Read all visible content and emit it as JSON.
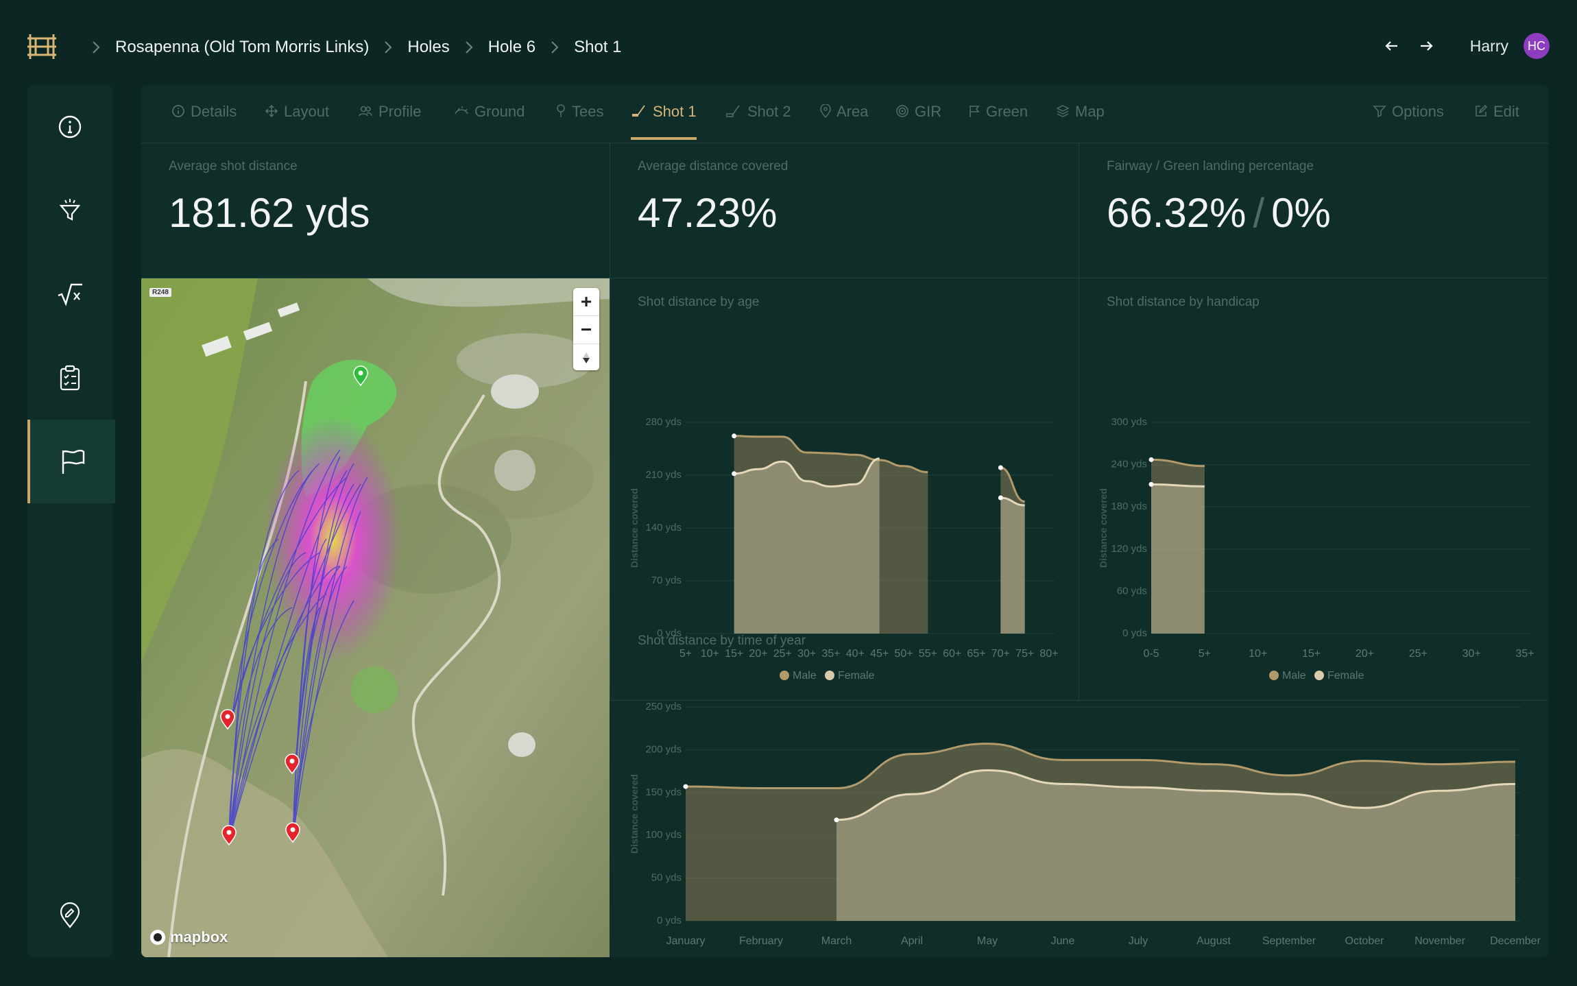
{
  "breadcrumb": {
    "items": [
      "Rosapenna (Old Tom Morris Links)",
      "Holes",
      "Hole 6",
      "Shot 1"
    ]
  },
  "user": {
    "name": "Harry",
    "initials": "HC"
  },
  "tabs": [
    {
      "label": "Details",
      "icon": "info-icon"
    },
    {
      "label": "Layout",
      "icon": "move-icon"
    },
    {
      "label": "Profile",
      "icon": "users-icon"
    },
    {
      "label": "Ground",
      "icon": "ground-icon"
    },
    {
      "label": "Tees",
      "icon": "tee-icon"
    },
    {
      "label": "Shot 1",
      "icon": "club-icon",
      "active": true
    },
    {
      "label": "Shot 2",
      "icon": "club-icon"
    },
    {
      "label": "Area",
      "icon": "pin-icon"
    },
    {
      "label": "GIR",
      "icon": "target-icon"
    },
    {
      "label": "Green",
      "icon": "flag-icon"
    },
    {
      "label": "Map",
      "icon": "layers-icon"
    }
  ],
  "actions": {
    "options": "Options",
    "edit": "Edit"
  },
  "kpis": {
    "avg_shot_distance": {
      "label": "Average shot distance",
      "value": "181.62 yds"
    },
    "avg_distance_covered": {
      "label": "Average distance covered",
      "value": "47.23%"
    },
    "landing_pct": {
      "label": "Fairway / Green landing percentage",
      "fairway": "66.32%",
      "green": "0%",
      "separator": "/"
    }
  },
  "map": {
    "badge": "R248",
    "attribution": "mapbox"
  },
  "colors": {
    "male": "#b39a6b",
    "female": "#d8cba9",
    "accent": "#c9a86a",
    "background": "#0c2723",
    "panel": "#0f2e29"
  },
  "chart_data": [
    {
      "id": "age",
      "type": "area",
      "title": "Shot distance by age",
      "ylabel": "Distance covered",
      "ytick_labels": [
        "0 yds",
        "70 yds",
        "140 yds",
        "210 yds",
        "280 yds"
      ],
      "ylim": [
        0,
        280
      ],
      "categories": [
        "5+",
        "10+",
        "15+",
        "20+",
        "25+",
        "30+",
        "35+",
        "40+",
        "45+",
        "50+",
        "55+",
        "60+",
        "65+",
        "70+",
        "75+",
        "80+"
      ],
      "series": [
        {
          "name": "Male",
          "values": [
            null,
            null,
            262,
            261,
            261,
            240,
            239,
            237,
            230,
            222,
            214,
            null,
            null,
            220,
            175,
            null
          ]
        },
        {
          "name": "Female",
          "values": [
            null,
            null,
            212,
            218,
            228,
            202,
            195,
            198,
            232,
            null,
            null,
            null,
            null,
            180,
            170,
            null
          ]
        }
      ],
      "legend": "bottom"
    },
    {
      "id": "handicap",
      "type": "area",
      "title": "Shot distance by handicap",
      "ylabel": "Distance covered",
      "ytick_labels": [
        "0 yds",
        "60 yds",
        "120 yds",
        "180 yds",
        "240 yds",
        "300 yds"
      ],
      "ylim": [
        0,
        300
      ],
      "categories": [
        "0-5",
        "5+",
        "10+",
        "15+",
        "20+",
        "25+",
        "30+",
        "35+"
      ],
      "series": [
        {
          "name": "Male",
          "values": [
            247,
            238,
            null,
            null,
            null,
            null,
            null,
            null
          ]
        },
        {
          "name": "Female",
          "values": [
            212,
            209,
            null,
            null,
            null,
            null,
            null,
            null
          ]
        }
      ],
      "legend": "bottom"
    },
    {
      "id": "time",
      "type": "area",
      "title": "Shot distance by time of year",
      "ylabel": "Distance covered",
      "ytick_labels": [
        "0 yds",
        "50 yds",
        "100 yds",
        "150 yds",
        "200 yds",
        "250 yds"
      ],
      "ylim": [
        0,
        250
      ],
      "categories": [
        "January",
        "February",
        "March",
        "April",
        "May",
        "June",
        "July",
        "August",
        "September",
        "October",
        "November",
        "December"
      ],
      "series": [
        {
          "name": "Male",
          "values": [
            157,
            155,
            155,
            195,
            207,
            188,
            188,
            183,
            170,
            187,
            183,
            186
          ]
        },
        {
          "name": "Female",
          "values": [
            null,
            null,
            118,
            148,
            176,
            160,
            156,
            152,
            148,
            132,
            152,
            160
          ]
        }
      ],
      "legend": "bottom"
    }
  ]
}
